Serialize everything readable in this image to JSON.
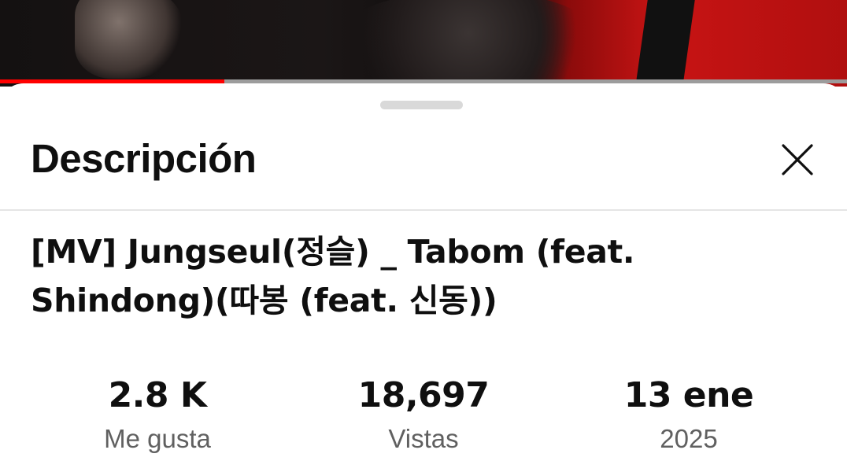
{
  "player": {
    "progress_fraction": 0.265,
    "accent_color": "#ff0000"
  },
  "sheet": {
    "title": "Descripción",
    "close_icon": "close-icon"
  },
  "video": {
    "title": "[MV] Jungseul(정슬) _ Tabom (feat. Shindong)(따봉 (feat. 신동))"
  },
  "stats": [
    {
      "value": "2.8 K",
      "label": "Me gusta"
    },
    {
      "value": "18,697",
      "label": "Vistas"
    },
    {
      "value": "13 ene",
      "label": "2025"
    }
  ]
}
